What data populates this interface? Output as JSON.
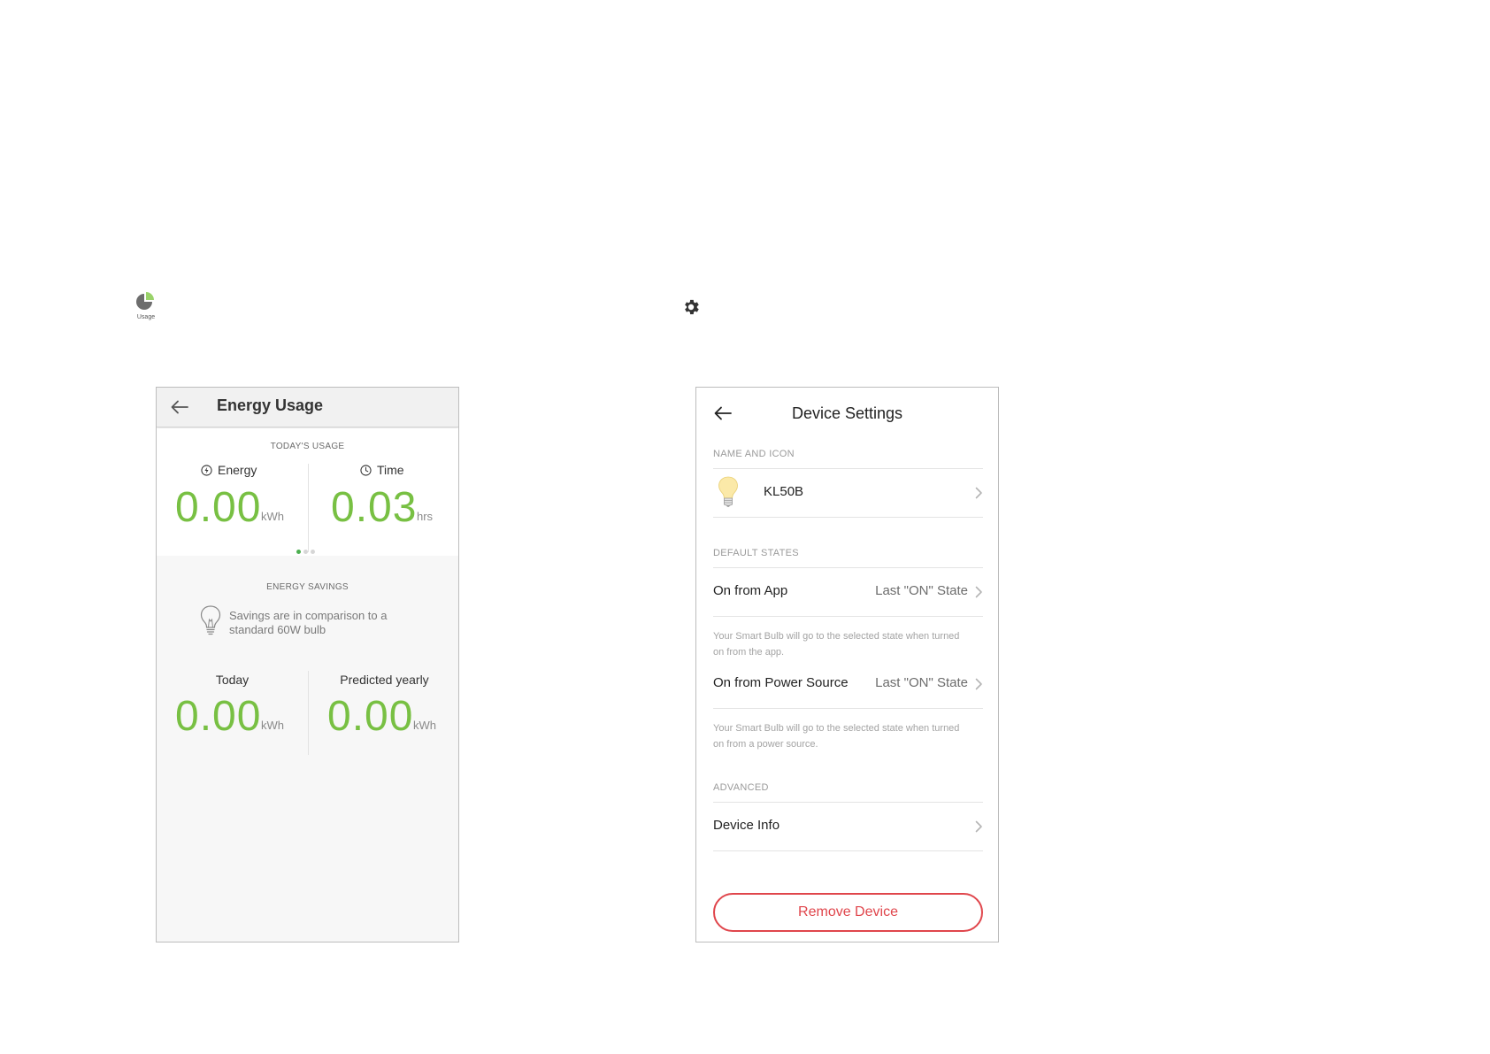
{
  "floating_icons": {
    "usage_icon_label": "Usage"
  },
  "energy_usage": {
    "title": "Energy Usage",
    "todays_usage_label": "TODAY'S USAGE",
    "energy": {
      "label": "Energy",
      "value": "0.00",
      "unit": "kWh"
    },
    "time": {
      "label": "Time",
      "value": "0.03",
      "unit": "hrs"
    },
    "page_indicator": {
      "count": 3,
      "active": 0
    },
    "energy_savings_label": "ENERGY SAVINGS",
    "savings_note": "Savings are in comparison to a standard 60W bulb",
    "today": {
      "label": "Today",
      "value": "0.00",
      "unit": "kWh"
    },
    "predicted_yearly": {
      "label": "Predicted yearly",
      "value": "0.00",
      "unit": "kWh"
    }
  },
  "device_settings": {
    "title": "Device Settings",
    "name_and_icon_label": "NAME AND ICON",
    "device_name": "KL50B",
    "default_states_label": "DEFAULT STATES",
    "on_from_app": {
      "label": "On from App",
      "value": "Last \"ON\" State",
      "hint": "Your Smart Bulb will go to the selected state when turned on from the app."
    },
    "on_from_power": {
      "label": "On from Power Source",
      "value": "Last \"ON\" State",
      "hint": "Your Smart Bulb will go to the selected state when turned on from a power source."
    },
    "advanced_label": "ADVANCED",
    "device_info_label": "Device Info",
    "remove_button_label": "Remove Device"
  },
  "colors": {
    "accent_green": "#78c043",
    "danger_red": "#e0464c"
  }
}
